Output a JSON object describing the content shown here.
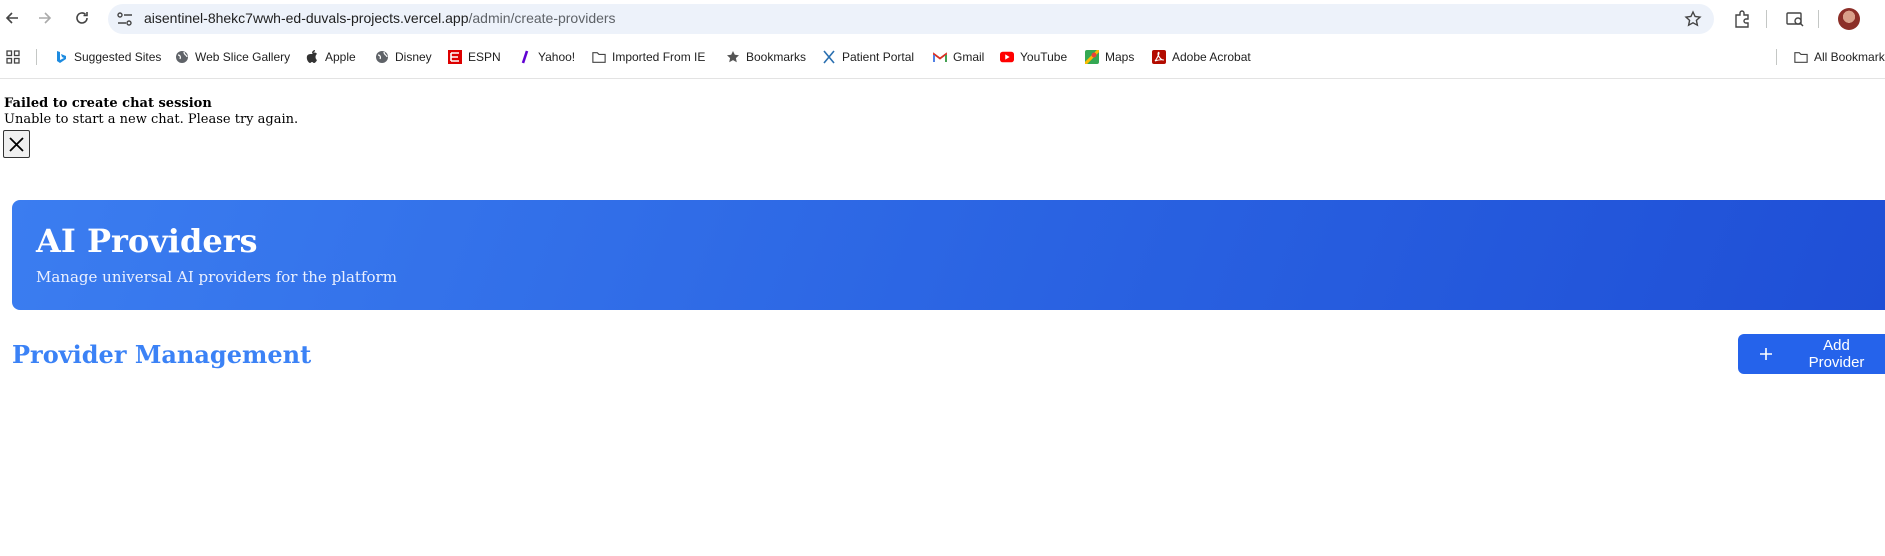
{
  "browser": {
    "url_host": "aisentinel-8hekc7wwh-ed-duvals-projects.vercel.app",
    "url_path": "/admin/create-providers"
  },
  "bookmarks": [
    {
      "label": "Suggested Sites",
      "icon": "bing-icon"
    },
    {
      "label": "Web Slice Gallery",
      "icon": "globe-icon"
    },
    {
      "label": "Apple",
      "icon": "apple-icon"
    },
    {
      "label": "Disney",
      "icon": "globe-icon"
    },
    {
      "label": "ESPN",
      "icon": "espn-icon"
    },
    {
      "label": "Yahoo!",
      "icon": "yahoo-icon"
    },
    {
      "label": "Imported From IE",
      "icon": "folder-icon"
    },
    {
      "label": "Bookmarks",
      "icon": "star-icon"
    },
    {
      "label": "Patient Portal",
      "icon": "x-logo-icon"
    },
    {
      "label": "Gmail",
      "icon": "gmail-icon"
    },
    {
      "label": "YouTube",
      "icon": "youtube-icon"
    },
    {
      "label": "Maps",
      "icon": "maps-icon"
    },
    {
      "label": "Adobe Acrobat",
      "icon": "acrobat-icon"
    }
  ],
  "all_bookmarks_label": "All Bookmarks",
  "error": {
    "title": "Failed to create chat session",
    "message": "Unable to start a new chat. Please try again."
  },
  "hero": {
    "title": "AI Providers",
    "subtitle": "Manage universal AI providers for the platform"
  },
  "section": {
    "title": "Provider Management",
    "add_label": "Add Provider"
  },
  "colors": {
    "hero_start": "#3b7df0",
    "hero_end": "#1f4fd6",
    "section_title": "#3b82f6",
    "primary_button": "#2563eb"
  }
}
